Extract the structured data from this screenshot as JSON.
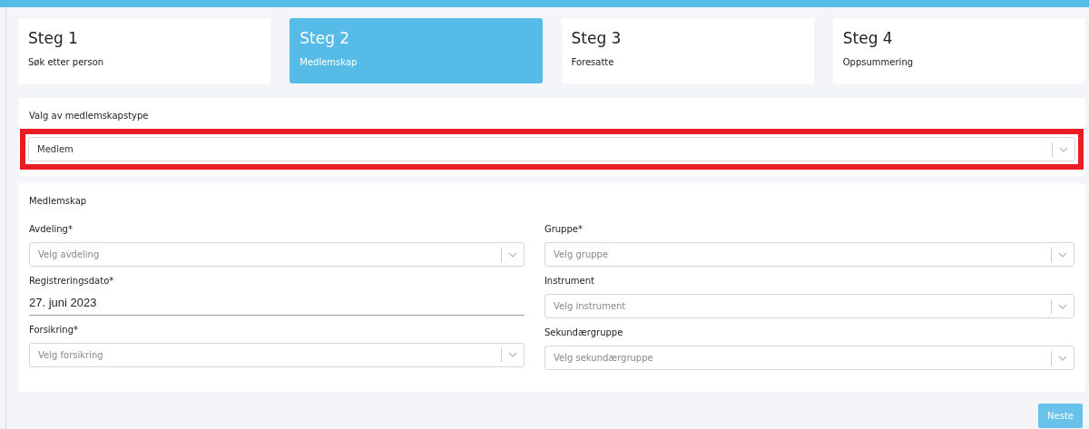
{
  "steps": [
    {
      "title": "Steg 1",
      "subtitle": "Søk etter person",
      "selected": false
    },
    {
      "title": "Steg 2",
      "subtitle": "Medlemskap",
      "selected": true
    },
    {
      "title": "Steg 3",
      "subtitle": "Foresatte",
      "selected": false
    },
    {
      "title": "Steg 4",
      "subtitle": "Oppsummering",
      "selected": false
    }
  ],
  "membership_type": {
    "label": "Valg av medlemskapstype",
    "value": "Medlem",
    "highlighted": true
  },
  "membership": {
    "title": "Medlemskap",
    "left": [
      {
        "kind": "select",
        "label": "Avdeling*",
        "placeholder": "Velg avdeling"
      },
      {
        "kind": "date",
        "label": "Registreringsdato*",
        "value": "27. juni 2023"
      },
      {
        "kind": "select",
        "label": "Forsikring*",
        "placeholder": "Velg forsikring"
      }
    ],
    "right": [
      {
        "kind": "select",
        "label": "Gruppe*",
        "placeholder": "Velg gruppe"
      },
      {
        "kind": "select",
        "label": "Instrument",
        "placeholder": "Velg instrument"
      },
      {
        "kind": "select",
        "label": "Sekundærgruppe",
        "placeholder": "Velg sekundærgruppe"
      }
    ]
  },
  "next_button": {
    "label": "Neste",
    "disabled": true
  }
}
